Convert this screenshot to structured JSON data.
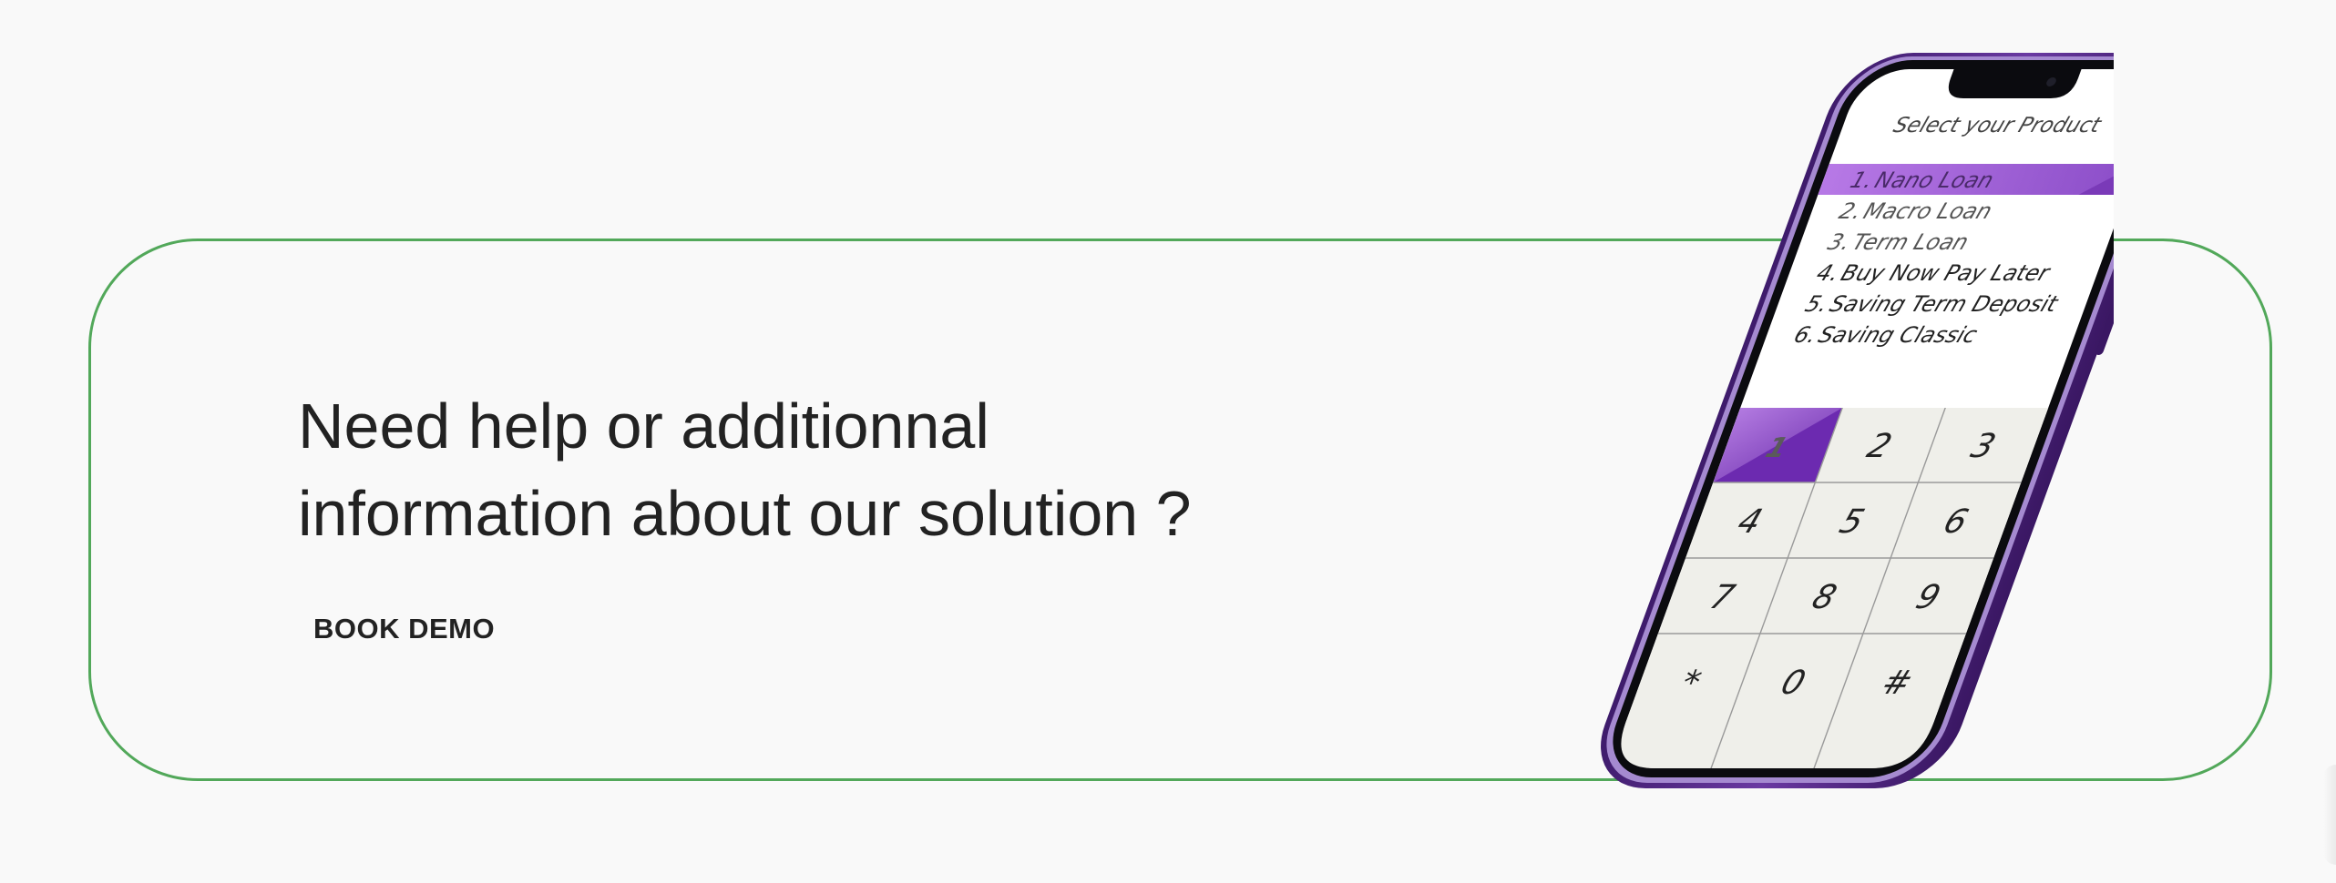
{
  "cta": {
    "headline_line1": "Need help or additionnal",
    "headline_line2": "information about our solution ?",
    "button_label": "BOOK DEMO"
  },
  "phone": {
    "screen_title": "Select your Product",
    "menu": [
      {
        "number": "1.",
        "label": "Nano Loan",
        "selected": true
      },
      {
        "number": "2.",
        "label": "Macro Loan",
        "selected": false
      },
      {
        "number": "3.",
        "label": "Term Loan",
        "selected": false
      },
      {
        "number": "4.",
        "label": "Buy Now Pay Later",
        "selected": false
      },
      {
        "number": "5.",
        "label": "Saving Term Deposit",
        "selected": false
      },
      {
        "number": "6.",
        "label": "Saving Classic",
        "selected": false
      }
    ],
    "keypad": [
      "1",
      "2",
      "3",
      "4",
      "5",
      "6",
      "7",
      "8",
      "9",
      "*",
      "0",
      "#"
    ],
    "active_key": "1"
  },
  "colors": {
    "card_border": "#52a85a",
    "text": "#222222",
    "phone_frame": "#5b2d8e",
    "accent_purple": "#a565d8",
    "keypad_bg": "#efefea"
  },
  "icons": {
    "phone_illustration": "smartphone-icon"
  }
}
